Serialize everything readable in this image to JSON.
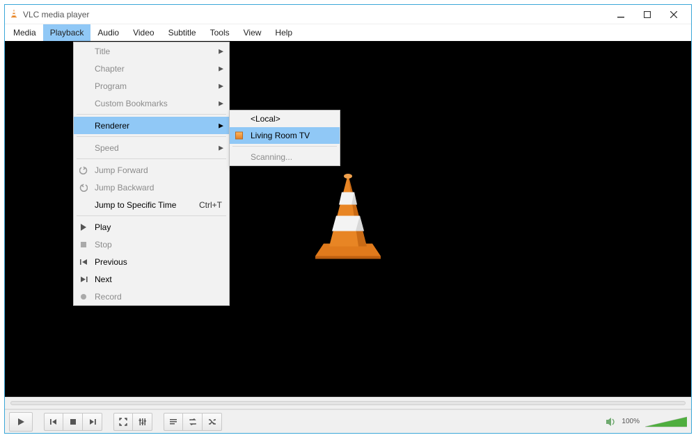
{
  "title": "VLC media player",
  "menubar": [
    "Media",
    "Playback",
    "Audio",
    "Video",
    "Subtitle",
    "Tools",
    "View",
    "Help"
  ],
  "active_menu_index": 1,
  "playback_menu": {
    "title": {
      "label": "Title",
      "enabled": false,
      "submenu": true
    },
    "chapter": {
      "label": "Chapter",
      "enabled": false,
      "submenu": true
    },
    "program": {
      "label": "Program",
      "enabled": false,
      "submenu": true
    },
    "custom_bookmarks": {
      "label": "Custom Bookmarks",
      "enabled": false,
      "submenu": true
    },
    "renderer": {
      "label": "Renderer",
      "enabled": true,
      "submenu": true,
      "hover": true
    },
    "speed": {
      "label": "Speed",
      "enabled": false,
      "submenu": true
    },
    "jump_forward": {
      "label": "Jump Forward",
      "enabled": false
    },
    "jump_backward": {
      "label": "Jump Backward",
      "enabled": false
    },
    "jump_to_time": {
      "label": "Jump to Specific Time",
      "enabled": true,
      "shortcut": "Ctrl+T"
    },
    "play": {
      "label": "Play",
      "enabled": true
    },
    "stop": {
      "label": "Stop",
      "enabled": false
    },
    "previous": {
      "label": "Previous",
      "enabled": true
    },
    "next": {
      "label": "Next",
      "enabled": true
    },
    "record": {
      "label": "Record",
      "enabled": false
    }
  },
  "renderer_submenu": {
    "local": {
      "label": "<Local>"
    },
    "living_room_tv": {
      "label": "Living Room TV",
      "hover": true,
      "radio": true
    },
    "scanning": {
      "label": "Scanning...",
      "enabled": false
    }
  },
  "volume": {
    "percent_label": "100%",
    "value": 100
  }
}
